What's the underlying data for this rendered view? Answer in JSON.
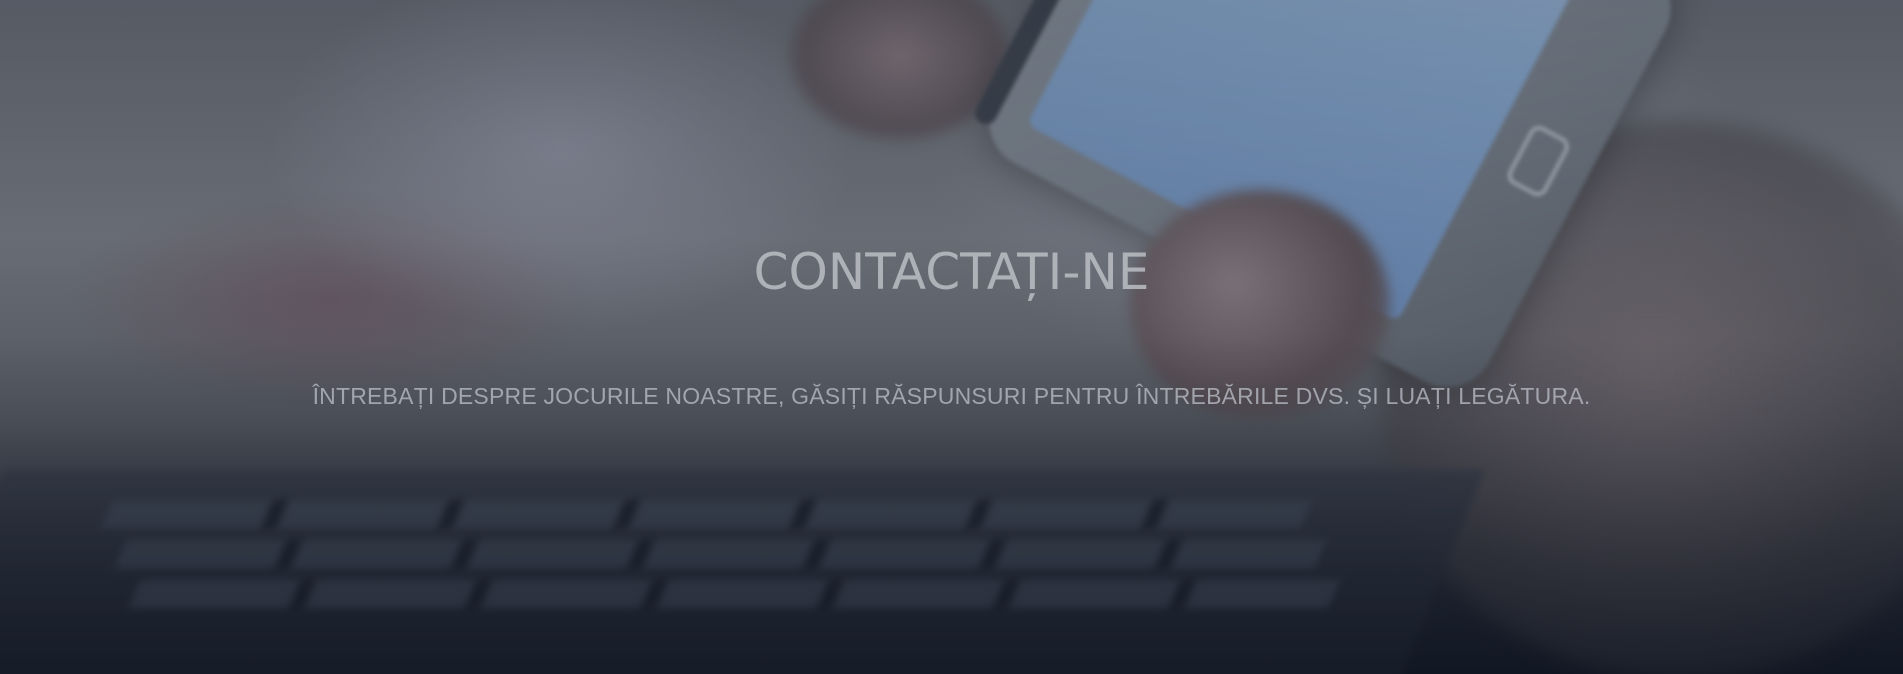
{
  "hero": {
    "title": "CONTACTAȚI-NE",
    "subtitle": "ÎNTREBAȚI DESPRE JOCURILE NOASTRE, GĂSIȚI RĂSPUNSURI PENTRU ÎNTREBĂRILE DVS. ȘI LUAȚI LEGĂTURA."
  },
  "colors": {
    "text": "#c3c6cc",
    "overlay": "#141a26"
  }
}
